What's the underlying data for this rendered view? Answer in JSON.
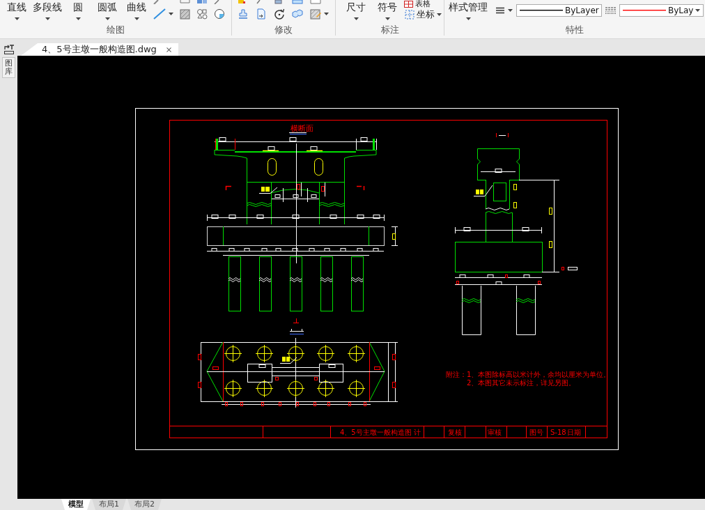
{
  "ribbon": {
    "groups": [
      {
        "kind": "draw",
        "label": "绘图",
        "buttons": [
          {
            "label": "直线"
          },
          {
            "label": "多段线"
          },
          {
            "label": "圆"
          },
          {
            "label": "圆弧"
          },
          {
            "label": "曲线"
          }
        ]
      },
      {
        "kind": "modify",
        "label": "修改"
      },
      {
        "kind": "annotate",
        "label": "标注",
        "buttons": [
          {
            "label": "尺寸"
          },
          {
            "label": "符号"
          }
        ],
        "small_buttons": [
          {
            "label": "表格"
          },
          {
            "label": "坐标"
          }
        ]
      },
      {
        "kind": "properties",
        "label": "特性",
        "buttons": [
          {
            "label": "样式管理"
          }
        ],
        "dropdowns": [
          {
            "value": "ByLayer",
            "color": "#000000"
          },
          {
            "value": "ByLay",
            "color": "#ff0000"
          }
        ]
      }
    ]
  },
  "document_tab": {
    "title": "4、5号主墩一般构造图.dwg"
  },
  "side_panel": {
    "label": "图库"
  },
  "drawing": {
    "section_title": "横断面",
    "notes": [
      "附注：1、本图除标高以米计外，余均以厘米为单位。",
      "2、本图其它未示标注，详见另图。"
    ],
    "title_block": {
      "drawing_title": "4、5号主墩一般构造图",
      "labels": [
        "计",
        "复核",
        "审核",
        "图号",
        "S-18",
        "日期"
      ]
    }
  },
  "layout_tabs": [
    {
      "label": "模型",
      "selected": true
    },
    {
      "label": "布局1",
      "selected": false
    },
    {
      "label": "布局2",
      "selected": false
    }
  ]
}
